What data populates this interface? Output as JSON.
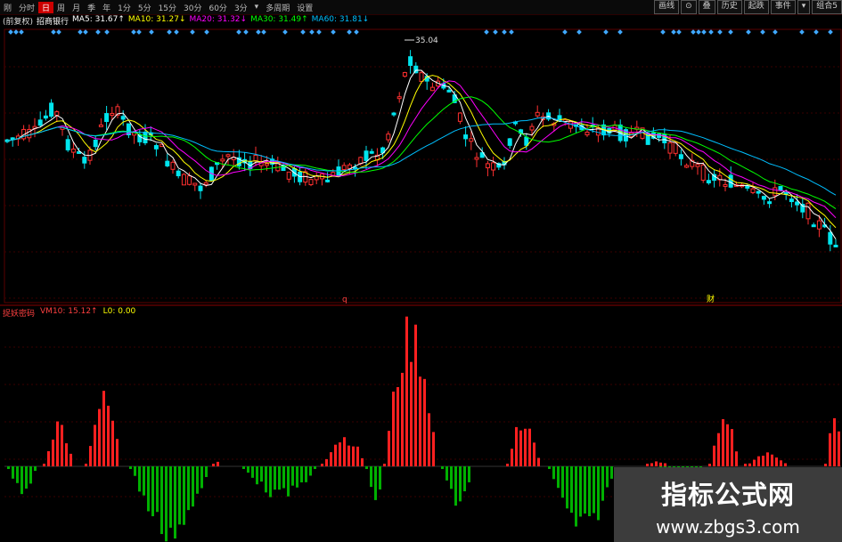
{
  "topbar": {
    "tabs": [
      "刚",
      "分时",
      "日",
      "周",
      "月",
      "季",
      "年",
      "1分",
      "5分",
      "15分",
      "30分",
      "60分",
      "3分",
      "▾",
      "多周期",
      "设置"
    ],
    "active_index": 2,
    "right_buttons": [
      "画线",
      "⊙",
      "叠",
      "历史",
      "起跌",
      "事件",
      "▾",
      "组合5"
    ]
  },
  "price_panel": {
    "stock": "招商银行",
    "mode": "(前复权)",
    "ma_labels": [
      "MA5: 31.67↑",
      "MA10: 31.27↓",
      "MA20: 31.32↓",
      "MA30: 31.49↑",
      "MA60: 31.81↓"
    ],
    "ma_colors": [
      "#ffffff",
      "#ffff00",
      "#ff00ff",
      "#00ff00",
      "#00bfff"
    ],
    "high_label": "35.04",
    "markers": [
      "q",
      "财"
    ]
  },
  "indicator_panel": {
    "name": "捉妖密码",
    "labels": [
      "VM10: 15.12↑",
      "L0: 0.00"
    ],
    "up_color": "#ff2020",
    "down_color": "#00b000"
  },
  "watermark": {
    "title": "指标公式网",
    "url": "www.zbgs3.com"
  }
}
